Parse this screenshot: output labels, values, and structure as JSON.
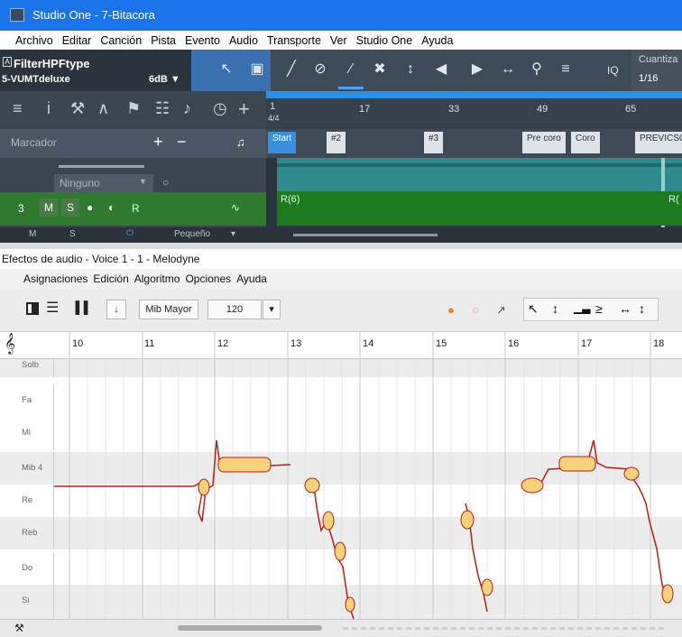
{
  "app": {
    "title": "Studio One - 7-Bitacora"
  },
  "menubar": [
    "Archivo",
    "Editar",
    "Canción",
    "Pista",
    "Evento",
    "Audio",
    "Transporte",
    "Ver",
    "Studio One",
    "Ayuda"
  ],
  "track_info": {
    "plugin": "FilterHPFtype",
    "preset": "5-VUMTdeluxe",
    "gain": "6dB ▼"
  },
  "toolbar": {
    "iq_label": "IQ",
    "quant_label": "Cuantiza",
    "quant_value": "1/16"
  },
  "ruler": {
    "sig": "4/4",
    "bars": [
      "1",
      "17",
      "33",
      "49",
      "65"
    ]
  },
  "marker_row": {
    "label": "Marcador",
    "plus": "+",
    "minus": "−",
    "markers": [
      "Start",
      "#2",
      "#3",
      "Pre coro",
      "Coro",
      "PREVICSO"
    ]
  },
  "tracks": {
    "send_label": "Ninguno",
    "track_num": "3",
    "btn_m": "M",
    "btn_s": "S",
    "btn_r": "R",
    "clip_green_label": "R(6)",
    "clip_green_label2": "R(",
    "bar_m": "M",
    "bar_s": "S",
    "bar_size": "Pequeño"
  },
  "fx": {
    "title": "Efectos de audio - Voice 1 - 1 - Melodyne",
    "menu": [
      "Asignaciones",
      "Edición",
      "Algoritmo",
      "Opciones",
      "Ayuda"
    ],
    "scale": "Mib Mayor",
    "tempo": "120"
  },
  "melodyne": {
    "bars": [
      "10",
      "11",
      "12",
      "13",
      "14",
      "15",
      "16",
      "17",
      "18"
    ],
    "notes": [
      "Solb",
      "Fa",
      "Mi",
      "Mib 4",
      "Re",
      "Reb",
      "Do",
      "Si"
    ]
  },
  "colors": {
    "blob_fill": "#f6d07a",
    "blob_edge": "#b0201c",
    "title_blue": "#1a73e8"
  }
}
